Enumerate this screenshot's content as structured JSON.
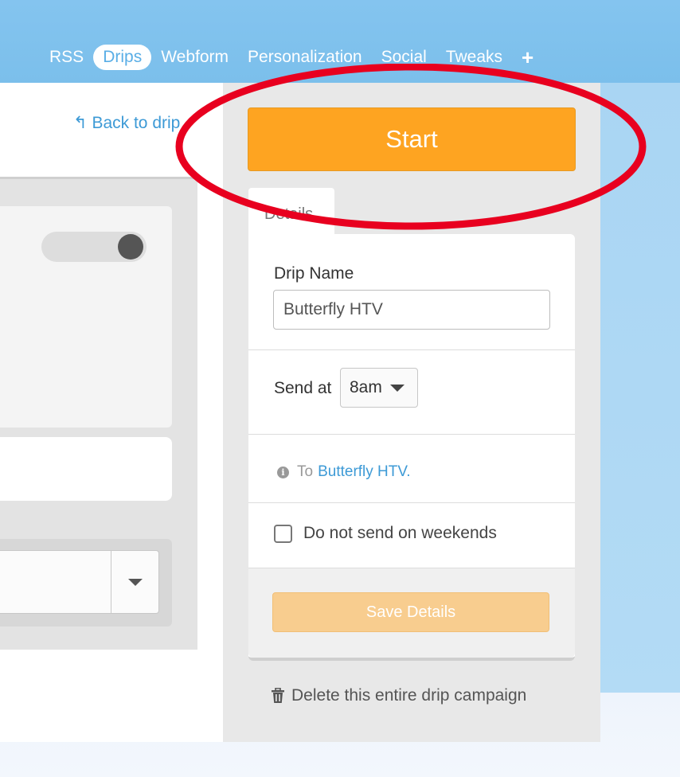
{
  "nav": {
    "items": [
      {
        "label": "RSS",
        "active": false
      },
      {
        "label": "Drips",
        "active": true
      },
      {
        "label": "Webform",
        "active": false
      },
      {
        "label": "Personalization",
        "active": false
      },
      {
        "label": "Social",
        "active": false
      },
      {
        "label": "Tweaks",
        "active": false
      }
    ],
    "add_label": "+"
  },
  "left": {
    "back_link": "Back to drip",
    "back_icon": "reply-arrow-icon"
  },
  "panel": {
    "start_label": "Start",
    "tab_details": "Details",
    "drip_name_label": "Drip Name",
    "drip_name_value": "Butterfly HTV",
    "send_at_label": "Send at",
    "send_at_value": "8am",
    "to_prefix": "To",
    "to_link": "Butterfly HTV.",
    "weekend_label": "Do not send on weekends",
    "weekend_checked": false,
    "save_label": "Save Details",
    "delete_label": "Delete this entire drip campaign"
  },
  "colors": {
    "header_blue": "#84c4ef",
    "start_orange": "#fea421",
    "save_orange_disabled": "#f8cd8f",
    "link_blue": "#3d9ad6",
    "annotation_red": "#e8001f"
  }
}
